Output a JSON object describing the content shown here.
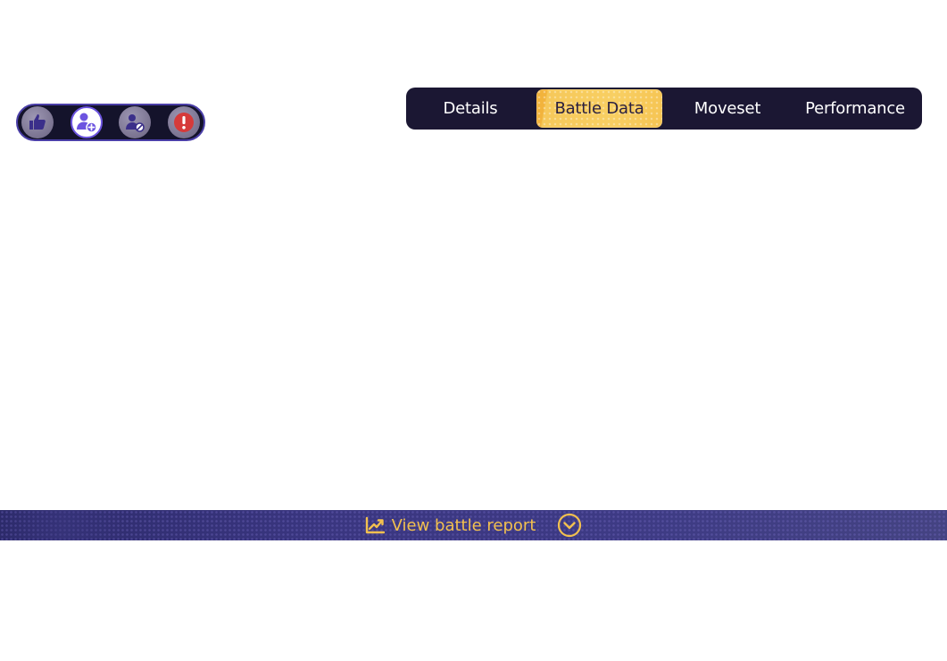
{
  "actions": {
    "like_icon": "thumbs-up-icon",
    "add_friend_icon": "add-friend-icon",
    "block_icon": "block-user-icon",
    "report_icon": "alert-icon",
    "active_index": 1
  },
  "tabs": [
    {
      "label": "Details",
      "active": false
    },
    {
      "label": "Battle Data",
      "active": true
    },
    {
      "label": "Moveset",
      "active": false
    },
    {
      "label": "Performance",
      "active": false
    }
  ],
  "report": {
    "label": "View battle report",
    "icon": "line-chart-icon",
    "toggle_icon": "chevron-down-circle-icon"
  },
  "colors": {
    "accent": "#f2c04f",
    "tab_bar_bg": "#1b1733",
    "active_tab_bg": "#f8cf62",
    "report_bar_bg": "#3a3680",
    "active_action": "#6c54e0",
    "report_red": "#d63a3a"
  }
}
